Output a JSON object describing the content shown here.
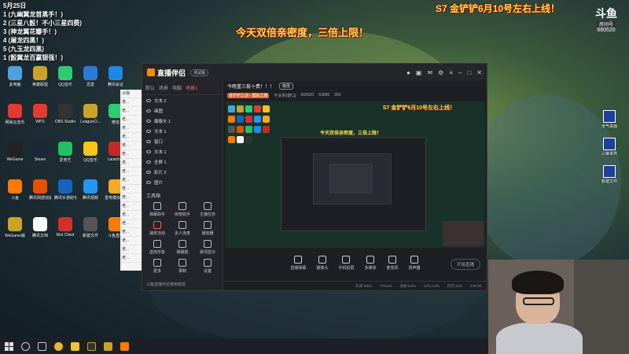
{
  "stream_overlay": {
    "date": "5月25日",
    "lines": [
      "1 (九幽翼龙首黑手！)",
      "2 (三星八骰！不小三星四费)",
      "3 (神龙翼花瓣手！)",
      "4 (屠龙四黑！)",
      "5 (九玉龙四黑)",
      "1 (骰翼龙百赢银强！)"
    ],
    "banner_main": "今天双倍亲密度，三倍上限！",
    "banner_top": "S7 金铲铲6月10号左右上线！",
    "platform_logo": "斗鱼",
    "room_label": "房间号",
    "room_number": "660520"
  },
  "desktop_icons": [
    {
      "label": "此电脑",
      "color": "#4aa3df"
    },
    {
      "label": "英雄联盟",
      "color": "#c9a227"
    },
    {
      "label": "QQ音乐",
      "color": "#2ecc71"
    },
    {
      "label": "迅雷",
      "color": "#2a7bd8"
    },
    {
      "label": "腾讯会议",
      "color": "#1e88e5"
    },
    {
      "label": "网易云音乐",
      "color": "#e53935"
    },
    {
      "label": "WPS",
      "color": "#e53935"
    },
    {
      "label": "OBS Studio",
      "color": "#333333"
    },
    {
      "label": "LeagueCl...",
      "color": "#c9a227"
    },
    {
      "label": "微信",
      "color": "#2ecc71"
    },
    {
      "label": "WeGame",
      "color": "#222222"
    },
    {
      "label": "Steam",
      "color": "#1b2838"
    },
    {
      "label": "爱奇艺",
      "color": "#21c064"
    },
    {
      "label": "QQ音乐",
      "color": "#f5c518"
    },
    {
      "label": "Launcher",
      "color": "#c62828"
    },
    {
      "label": "斗鱼",
      "color": "#ff7a00"
    },
    {
      "label": "腾讯网游加速器",
      "color": "#e65100"
    },
    {
      "label": "腾讯手游助手",
      "color": "#1565c0"
    },
    {
      "label": "腾讯视频",
      "color": "#2196f3"
    },
    {
      "label": "雷电模拟器4",
      "color": "#f9a825"
    },
    {
      "label": "WeGame版",
      "color": "#c9a227"
    },
    {
      "label": "腾讯文档",
      "color": "#fafafa"
    },
    {
      "label": "Riot Client",
      "color": "#d32f2f"
    },
    {
      "label": "新建文件",
      "color": "#555555"
    },
    {
      "label": "斗鱼直播",
      "color": "#ff7a00"
    }
  ],
  "chat_messages": [
    "大咖",
    "老...",
    "老...",
    "老...",
    "老...",
    "老...",
    "老...",
    "老...",
    "老...",
    "老...",
    "老...",
    "老...",
    "老...",
    "老...",
    "老...",
    "老...",
    "老...",
    "老...",
    "老...",
    "老..."
  ],
  "app": {
    "name": "直播伴侣",
    "version": "测试版",
    "room_title": "今晚重三套十费！！！",
    "edit_label": "修改",
    "tag1": "金铲铲之战 - 模拟之路",
    "tag2": "不太帆(德Cj)",
    "room_id": "660520",
    "fans": "63986",
    "viewers": "262",
    "scene_tabs": [
      "默认",
      "场景",
      "电脑",
      "场景1"
    ],
    "sources": [
      "文本 2",
      "画图",
      "摄像头 1",
      "文本 1",
      "窗口",
      "文本 1",
      "全屏 1",
      "影片 2",
      "图片"
    ],
    "tools_title": "工具箱",
    "tools": [
      "弹幕助手",
      "房管助手",
      "主播任务",
      "抽奖活动",
      "多人连麦",
      "播放器",
      "虚拟形象",
      "弹幕姬",
      "歌词显示",
      "更多",
      "录制",
      "设置"
    ],
    "bottom_note": "斗鱼直播伴侣使用帮助",
    "toolbar": [
      "直播弹幕",
      "摄像头",
      "手机投屏",
      "多媒体",
      "麦克风",
      "扬声器"
    ],
    "start_live": "开始直播",
    "status": [
      "码率:0kb/s",
      "FPS:60",
      "丢帧:0.0%",
      "CPU:13%",
      "内存:33%",
      "0:00:00"
    ]
  },
  "right_icons": [
    {
      "label": "天气桌面"
    },
    {
      "label": "三维世界"
    },
    {
      "label": "新建文件"
    }
  ],
  "taskbar": [
    "start",
    "search",
    "task-view",
    "chrome",
    "explorer",
    "wegame",
    "lol",
    "douyu"
  ]
}
